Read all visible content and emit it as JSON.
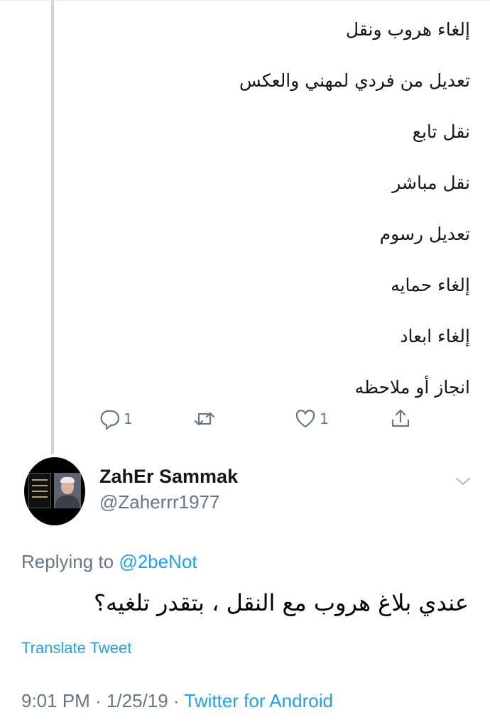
{
  "previous_tweet": {
    "lines": [
      "إلغاء هروب ونقل",
      "تعديل من فردي لمهني والعكس",
      "نقل تابع",
      "نقل مباشر",
      "تعديل رسوم",
      "إلغاء حمايه",
      "إلغاء ابعاد",
      "انجاز أو ملاحظه"
    ],
    "actions": {
      "reply_count": "1",
      "like_count": "1"
    }
  },
  "tweet": {
    "author_name": "ZahEr Sammak",
    "author_handle": "@Zaherrr1977",
    "replying_prefix": "Replying to",
    "replying_mention": "@2beNot",
    "text": "عندي بلاغ هروب مع النقل ، بتقدر تلغيه؟",
    "translate_label": "Translate Tweet",
    "time": "9:01 PM",
    "date": "1/25/19",
    "separator": "·",
    "source": "Twitter for Android"
  },
  "icons": {
    "reply": "reply-icon",
    "retweet": "retweet-icon",
    "like": "heart-icon",
    "share": "share-icon",
    "caret": "chevron-down-icon"
  },
  "colors": {
    "link": "#1da1f2",
    "secondary_text": "#657786",
    "thread_line": "#cdd5dc"
  }
}
